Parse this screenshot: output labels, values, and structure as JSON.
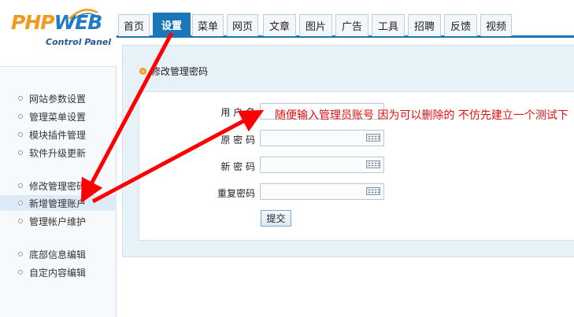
{
  "logo": {
    "php": "PHP",
    "web": "WEB",
    "subtitle": "Control Panel"
  },
  "nav": {
    "tabs": [
      {
        "label": "首页"
      },
      {
        "label": "设置"
      },
      {
        "label": "菜单"
      },
      {
        "label": "网页"
      },
      {
        "label": "文章"
      },
      {
        "label": "图片"
      },
      {
        "label": "广告"
      },
      {
        "label": "工具"
      },
      {
        "label": "招聘"
      },
      {
        "label": "反馈"
      },
      {
        "label": "视频"
      }
    ],
    "active_tab": "设置"
  },
  "sidebar": {
    "items": [
      {
        "label": "网站参数设置"
      },
      {
        "label": "管理菜单设置"
      },
      {
        "label": "模块插件管理"
      },
      {
        "label": "软件升级更新"
      },
      {
        "label": "修改管理密码"
      },
      {
        "label": "新增管理账户"
      },
      {
        "label": "管理帐户维护"
      },
      {
        "label": "底部信息编辑"
      },
      {
        "label": "自定内容编辑"
      }
    ],
    "active_item": "新增管理账户"
  },
  "form": {
    "section_title": "修改管理密码",
    "username_label": "用 户 名",
    "username_value": "",
    "old_password_label": "原 密 码",
    "new_password_label": "新 密 码",
    "confirm_password_label": "重复密码",
    "submit_label": "提交"
  },
  "annotation": {
    "text": "随便输入管理员账号  因为可以删除的  不仿先建立一个测试下",
    "color": "#e21010"
  },
  "colors": {
    "accent": "#1a78b8",
    "arrow": "#ff0000"
  },
  "icons": {
    "keyboard": "keyboard-icon",
    "bullet": "bullet-icon",
    "arrow": "red-arrow"
  }
}
